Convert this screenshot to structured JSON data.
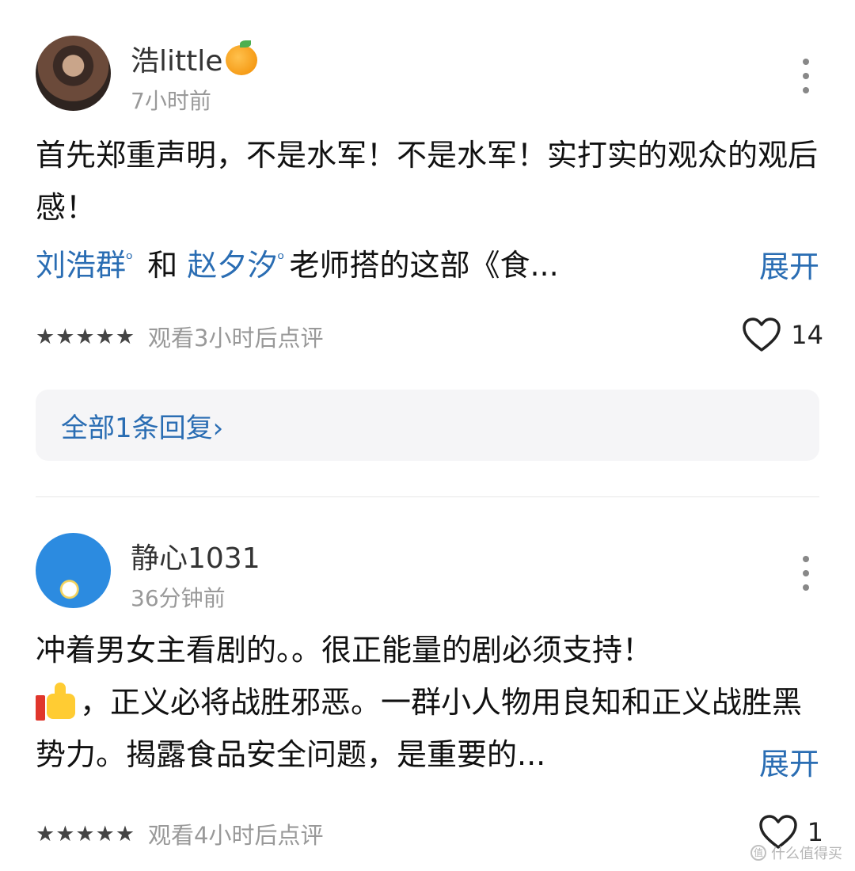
{
  "comments": [
    {
      "username": "浩little",
      "username_emoji": "orange",
      "time": "7小时前",
      "text_line1": "首先郑重声明，不是水军！不是水军！实打实的观众的观后感！",
      "mention1": "刘浩群",
      "connector": "和",
      "mention2": "赵夕汐",
      "text_after": "老师搭的这部《食...",
      "expand": "展开",
      "stars": "★★★★★",
      "watch_note": "观看3小时后点评",
      "likes": "14",
      "reply_link": "全部1条回复›"
    },
    {
      "username": "静心1031",
      "time": "36分钟前",
      "text_line1": "冲着男女主看剧的。。很正能量的剧必须支持！",
      "text_line2": "，正义必将战胜邪恶。一群小人物用良知和正义战胜黑势力。揭露食品安全问题，是重要的...",
      "emoji": "thumbs-up",
      "expand": "展开",
      "stars": "★★★★★",
      "watch_note": "观看4小时后点评",
      "likes": "1"
    }
  ],
  "icons": {
    "more": "more-vertical-icon",
    "like": "heart-icon",
    "mention": "search-icon"
  },
  "colors": {
    "link": "#2a6db3",
    "muted": "#999999"
  },
  "watermark": "什么值得买"
}
